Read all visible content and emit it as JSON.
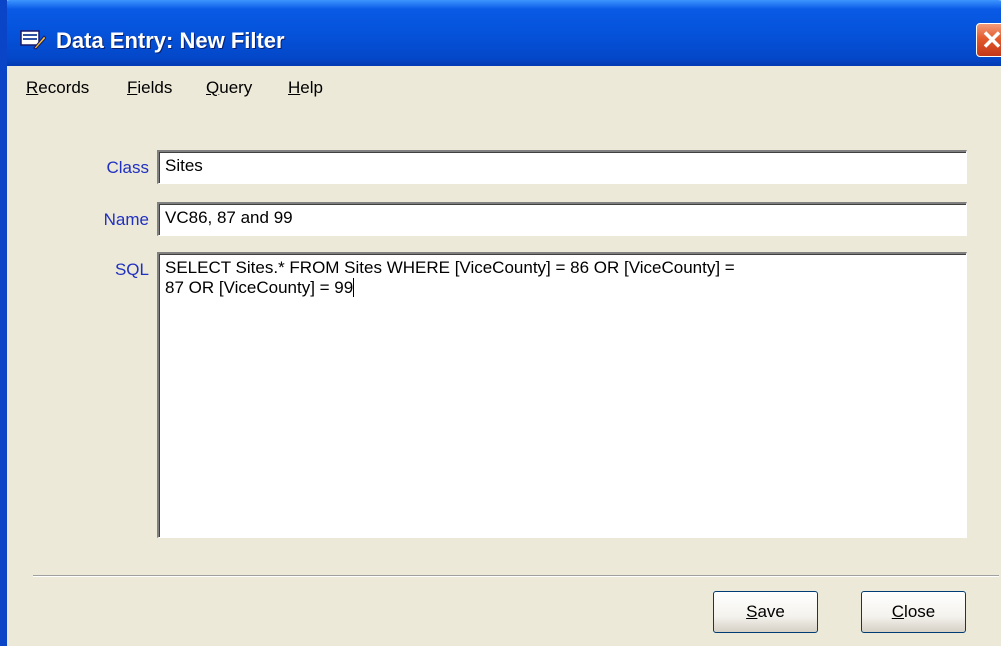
{
  "window": {
    "title": "Data Entry: New Filter",
    "icon": "form-icon",
    "close_glyph": "✕"
  },
  "menu": [
    {
      "key": "R",
      "rest": "ecords"
    },
    {
      "key": "F",
      "rest": "ields"
    },
    {
      "key": "Q",
      "rest": "uery"
    },
    {
      "key": "H",
      "rest": "elp"
    }
  ],
  "form": {
    "class_label": "Class",
    "class_value": "Sites",
    "name_label": "Name",
    "name_value": "VC86, 87 and 99",
    "sql_label": "SQL",
    "sql_value": "SELECT Sites.* FROM Sites WHERE [ViceCounty] = 86 OR [ViceCounty] =\n87 OR [ViceCounty] = 99"
  },
  "buttons": {
    "save_key": "S",
    "save_rest": "ave",
    "close_key": "C",
    "close_rest": "lose"
  },
  "colors": {
    "titlebar": "#0553da",
    "label_text": "#2030c0",
    "window_bg": "#ece9d8",
    "close_button": "#e35a2b"
  }
}
